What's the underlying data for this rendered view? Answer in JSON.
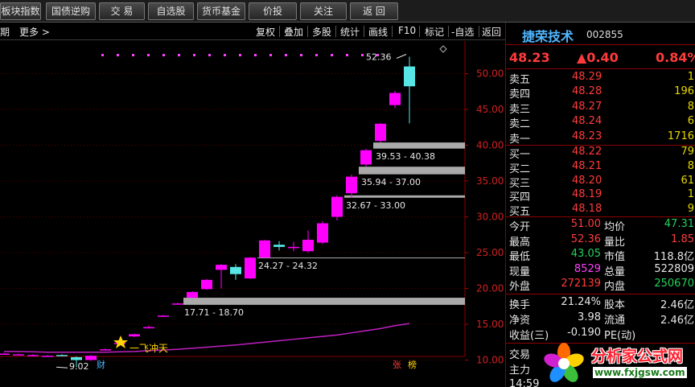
{
  "toolbar": {
    "buttons": [
      "板块指数",
      "国债逆购",
      "交 易",
      "自选股",
      "货币基金",
      "价投",
      "关注",
      "返 回"
    ]
  },
  "subbar": {
    "left": [
      "周期",
      "更多 >"
    ],
    "right": [
      "复权",
      "叠加",
      "多股",
      "统计",
      "画线",
      "F10",
      "标记",
      "-自选",
      "返回"
    ]
  },
  "chart": {
    "y_ticks": [
      "50.00",
      "45.00",
      "40.00",
      "35.00",
      "30.00",
      "25.00",
      "20.00",
      "15.00",
      "10.00"
    ],
    "high_marker": "52.36",
    "low_marker": "9.02",
    "gap_labels": [
      "39.53 - 40.38",
      "35.94 - 37.00",
      "32.67 - 33.00",
      "24.27 - 24.32",
      "17.71 - 18.70"
    ],
    "signal_text": "一飞冲天",
    "bottom_markers": [
      "财",
      "张",
      "榜"
    ],
    "colors": {
      "up": "#ff00ff",
      "down": "#57e6e6",
      "ma": "#c020c0",
      "gap": "#aaaaaa"
    }
  },
  "chart_data": {
    "type": "candlestick",
    "y_axis_range": [
      9,
      53
    ],
    "candles": [
      {
        "o": 10.9,
        "c": 10.9,
        "h": 11.0,
        "l": 10.8
      },
      {
        "o": 10.8,
        "c": 10.8,
        "h": 10.9,
        "l": 10.7
      },
      {
        "o": 10.7,
        "c": 10.7,
        "h": 10.8,
        "l": 10.6
      },
      {
        "o": 10.6,
        "c": 10.6,
        "h": 10.7,
        "l": 10.5
      },
      {
        "o": 10.7,
        "c": 10.6,
        "h": 10.8,
        "l": 10.5
      },
      {
        "o": 10.4,
        "c": 10.0,
        "h": 10.5,
        "l": 9.02
      },
      {
        "o": 10.0,
        "c": 10.6,
        "h": 10.7,
        "l": 9.9
      },
      {
        "o": 11.5,
        "c": 11.5,
        "h": 11.6,
        "l": 11.4
      },
      {
        "o": 12.4,
        "c": 12.4,
        "h": 12.5,
        "l": 12.3
      },
      {
        "o": 13.3,
        "c": 13.6,
        "h": 13.7,
        "l": 13.2
      },
      {
        "o": 14.6,
        "c": 14.6,
        "h": 14.8,
        "l": 14.4
      },
      {
        "o": 16.2,
        "c": 16.2,
        "h": 16.3,
        "l": 16.1
      },
      {
        "o": 17.9,
        "c": 17.9,
        "h": 18.0,
        "l": 17.71
      },
      {
        "o": 18.7,
        "c": 19.5,
        "h": 19.6,
        "l": 18.7
      },
      {
        "o": 19.9,
        "c": 21.2,
        "h": 21.3,
        "l": 19.8
      },
      {
        "o": 22.6,
        "c": 23.3,
        "h": 23.4,
        "l": 20.0
      },
      {
        "o": 23.0,
        "c": 22.0,
        "h": 23.4,
        "l": 21.2
      },
      {
        "o": 21.4,
        "c": 24.3,
        "h": 24.4,
        "l": 21.3
      },
      {
        "o": 24.3,
        "c": 26.7,
        "h": 26.8,
        "l": 24.27
      },
      {
        "o": 26.1,
        "c": 25.8,
        "h": 26.6,
        "l": 25.3
      },
      {
        "o": 25.8,
        "c": 25.8,
        "h": 26.5,
        "l": 25.2
      },
      {
        "o": 25.2,
        "c": 26.8,
        "h": 28.1,
        "l": 25.0
      },
      {
        "o": 26.4,
        "c": 29.1,
        "h": 29.4,
        "l": 26.2
      },
      {
        "o": 30.0,
        "c": 32.8,
        "h": 33.0,
        "l": 29.5
      },
      {
        "o": 33.3,
        "c": 35.6,
        "h": 35.9,
        "l": 32.7
      },
      {
        "o": 37.3,
        "c": 39.3,
        "h": 39.5,
        "l": 37.0
      },
      {
        "o": 40.6,
        "c": 43.0,
        "h": 43.1,
        "l": 40.4
      },
      {
        "o": 45.6,
        "c": 47.3,
        "h": 47.6,
        "l": 45.2
      },
      {
        "o": 51.0,
        "c": 48.23,
        "h": 52.36,
        "l": 43.05
      }
    ],
    "ma": [
      11.2,
      11.2,
      11.15,
      11.1,
      11.1,
      11.1,
      11.1,
      11.1,
      11.15,
      11.2,
      11.3,
      11.4,
      11.5,
      11.65,
      11.8,
      11.95,
      12.1,
      12.3,
      12.5,
      12.7,
      12.9,
      13.1,
      13.3,
      13.5,
      13.8,
      14.1,
      14.4,
      14.8,
      15.1
    ]
  },
  "panel": {
    "name": "捷荣技术",
    "code": "002855",
    "price": "48.23",
    "change": "▲0.40",
    "change_pct": "0.84%",
    "asks": [
      {
        "label": "卖五",
        "price": "48.29",
        "vol": "1"
      },
      {
        "label": "卖四",
        "price": "48.28",
        "vol": "196"
      },
      {
        "label": "卖三",
        "price": "48.27",
        "vol": "8"
      },
      {
        "label": "卖二",
        "price": "48.24",
        "vol": "6"
      },
      {
        "label": "卖一",
        "price": "48.23",
        "vol": "1716"
      }
    ],
    "bids": [
      {
        "label": "买一",
        "price": "48.22",
        "vol": "79"
      },
      {
        "label": "买二",
        "price": "48.21",
        "vol": "8"
      },
      {
        "label": "买三",
        "price": "48.20",
        "vol": "61"
      },
      {
        "label": "买四",
        "price": "48.19",
        "vol": "1"
      },
      {
        "label": "买五",
        "price": "48.18",
        "vol": "9"
      }
    ],
    "stats1": [
      {
        "l1": "今开",
        "v1": "51.00",
        "l2": "均价",
        "v2": "47.31"
      },
      {
        "l1": "最高",
        "v1": "52.36",
        "l2": "量比",
        "v2": "1.85"
      },
      {
        "l1": "最低",
        "v1": "43.05",
        "l2": "市值",
        "v2": "118.8亿"
      },
      {
        "l1": "现量",
        "v1": "8529",
        "l2": "总量",
        "v2": "522809"
      },
      {
        "l1": "外盘",
        "v1": "272139",
        "l2": "内盘",
        "v2": "250670"
      }
    ],
    "stats2": [
      {
        "l1": "换手",
        "v1": "21.24%",
        "l2": "股本",
        "v2": "2.46亿"
      },
      {
        "l1": "净资",
        "v1": "3.98",
        "l2": "流通",
        "v2": "2.46亿"
      },
      {
        "l1": "收益(三)",
        "v1": "-0.190",
        "l2": "PE(动)",
        "v2": ""
      }
    ],
    "footer": [
      "交易",
      "主力"
    ],
    "time_partial": "14:59"
  },
  "watermark": {
    "text": "分析家公式网",
    "url": "www.fxjgsw.com"
  }
}
